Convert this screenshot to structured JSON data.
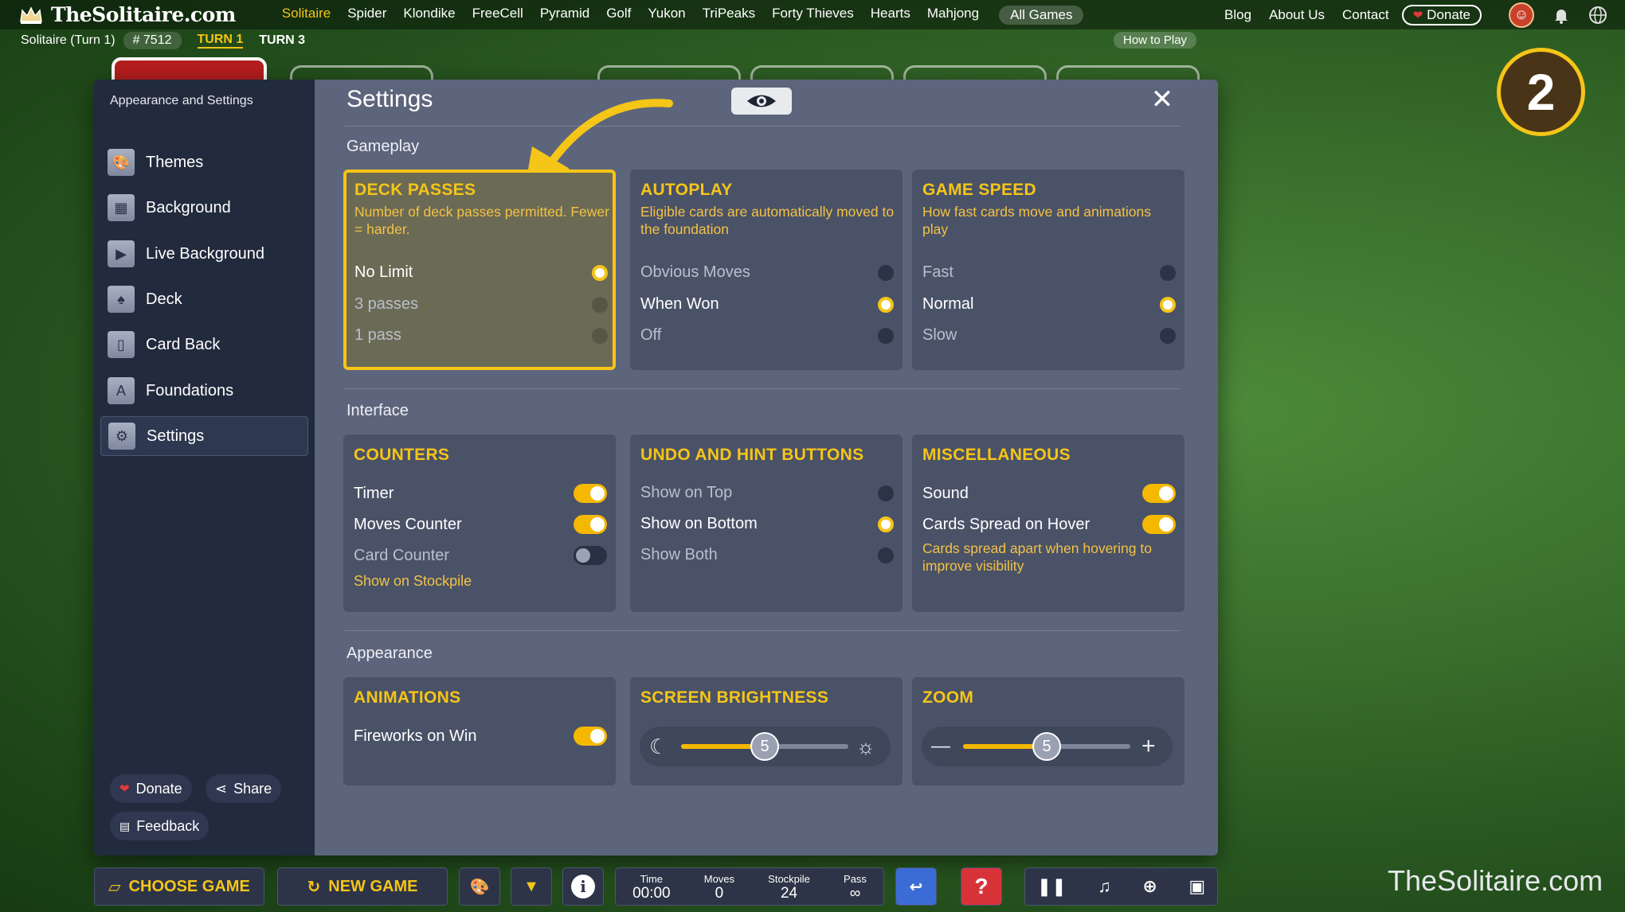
{
  "site": {
    "name": "TheSolitaire.com",
    "watermark": "TheSolitaire.com"
  },
  "nav": {
    "links": [
      "Solitaire",
      "Spider",
      "Klondike",
      "FreeCell",
      "Pyramid",
      "Golf",
      "Yukon",
      "TriPeaks",
      "Forty Thieves",
      "Hearts",
      "Mahjong"
    ],
    "all_games": "All Games",
    "blog": "Blog",
    "about": "About Us",
    "contact": "Contact",
    "donate": "Donate"
  },
  "subbar": {
    "game": "Solitaire (Turn 1)",
    "game_no": "# 7512",
    "turn1": "TURN 1",
    "turn3": "TURN 3",
    "how_to_play": "How to Play"
  },
  "badge": "2",
  "sidebar": {
    "title": "Appearance and Settings",
    "items": [
      {
        "label": "Themes",
        "icon": "palette-icon"
      },
      {
        "label": "Background",
        "icon": "image-icon"
      },
      {
        "label": "Live Background",
        "icon": "video-icon"
      },
      {
        "label": "Deck",
        "icon": "spade-icon"
      },
      {
        "label": "Card Back",
        "icon": "card-back-icon"
      },
      {
        "label": "Foundations",
        "icon": "foundation-icon"
      },
      {
        "label": "Settings",
        "icon": "gear-icon"
      }
    ],
    "donate": "Donate",
    "share": "Share",
    "feedback": "Feedback"
  },
  "settings": {
    "title": "Settings",
    "sections": {
      "gameplay": "Gameplay",
      "interface": "Interface",
      "appearance": "Appearance"
    },
    "deck_passes": {
      "title": "DECK PASSES",
      "desc": "Number of deck passes permitted. Fewer = harder.",
      "options": [
        "No Limit",
        "3 passes",
        "1 pass"
      ],
      "selected": "No Limit"
    },
    "autoplay": {
      "title": "AUTOPLAY",
      "desc": "Eligible cards are automatically moved to the foundation",
      "options": [
        "Obvious Moves",
        "When Won",
        "Off"
      ],
      "selected": "When Won"
    },
    "game_speed": {
      "title": "GAME SPEED",
      "desc": "How fast cards move and animations play",
      "options": [
        "Fast",
        "Normal",
        "Slow"
      ],
      "selected": "Normal"
    },
    "counters": {
      "title": "COUNTERS",
      "timer": "Timer",
      "moves": "Moves Counter",
      "card_counter": "Card Counter",
      "show_on_stockpile": "Show on Stockpile",
      "timer_on": true,
      "moves_on": true,
      "card_counter_on": false
    },
    "undo_hint": {
      "title": "UNDO AND HINT BUTTONS",
      "options": [
        "Show on Top",
        "Show on Bottom",
        "Show Both"
      ],
      "selected": "Show on Bottom"
    },
    "misc": {
      "title": "MISCELLANEOUS",
      "sound": "Sound",
      "spread": "Cards Spread on Hover",
      "spread_desc": "Cards spread apart when hovering to improve visibility",
      "sound_on": true,
      "spread_on": true
    },
    "animations": {
      "title": "ANIMATIONS",
      "fireworks": "Fireworks on Win",
      "fireworks_on": true
    },
    "brightness": {
      "title": "SCREEN BRIGHTNESS",
      "value": "5",
      "fraction": 0.5
    },
    "zoom": {
      "title": "ZOOM",
      "value": "5",
      "fraction": 0.5
    }
  },
  "toolbar": {
    "choose_game": "CHOOSE GAME",
    "new_game": "NEW GAME",
    "stats": [
      {
        "label": "Time",
        "value": "00:00"
      },
      {
        "label": "Moves",
        "value": "0"
      },
      {
        "label": "Stockpile",
        "value": "24"
      },
      {
        "label": "Pass",
        "value": "∞"
      }
    ]
  },
  "colors": {
    "accent": "#f5c518",
    "panel": "#5d657c",
    "sidebar": "#222a3d"
  }
}
